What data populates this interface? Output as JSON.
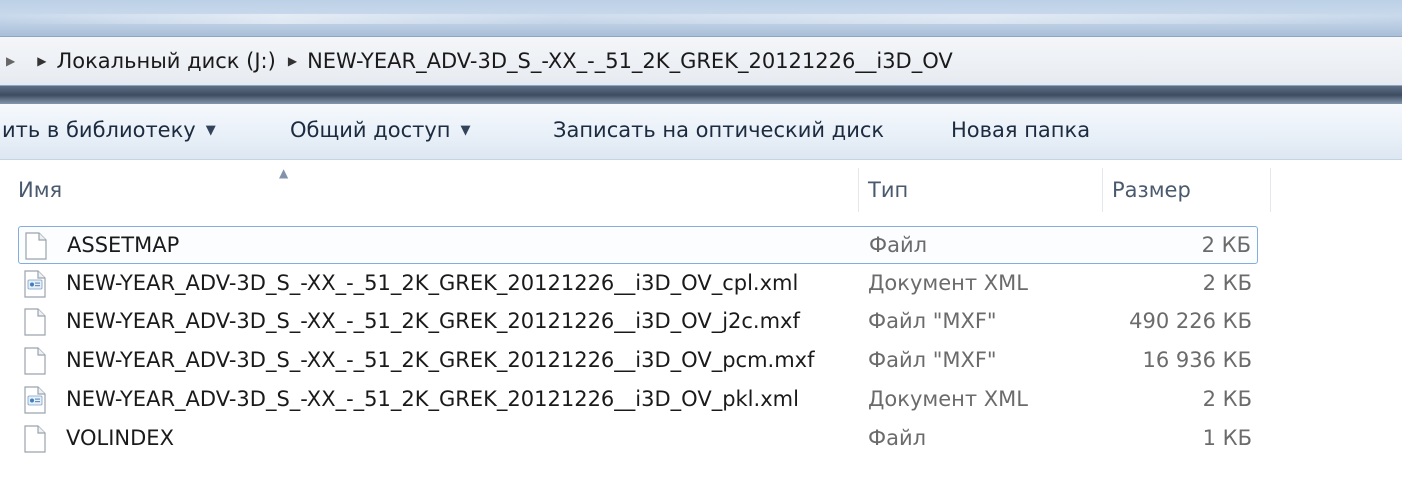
{
  "address_bar": {
    "crumbs": [
      "Локальный диск (J:)",
      "NEW-YEAR_ADV-3D_S_-XX_-_51_2K_GREK_20121226__i3D_OV"
    ]
  },
  "toolbar": {
    "add_to_library": "ить в библиотеку",
    "share": "Общий доступ",
    "burn": "Записать на оптический диск",
    "new_folder": "Новая папка"
  },
  "columns": {
    "name": "Имя",
    "type": "Тип",
    "size": "Размер"
  },
  "files": [
    {
      "name": "ASSETMAP",
      "type": "Файл",
      "size": "2 КБ",
      "icon": "file-icon",
      "selected": true
    },
    {
      "name": "NEW-YEAR_ADV-3D_S_-XX_-_51_2K_GREK_20121226__i3D_OV_cpl.xml",
      "type": "Документ XML",
      "size": "2 КБ",
      "icon": "xml-file-icon",
      "selected": false
    },
    {
      "name": "NEW-YEAR_ADV-3D_S_-XX_-_51_2K_GREK_20121226__i3D_OV_j2c.mxf",
      "type": "Файл \"MXF\"",
      "size": "490 226 КБ",
      "icon": "file-icon",
      "selected": false
    },
    {
      "name": "NEW-YEAR_ADV-3D_S_-XX_-_51_2K_GREK_20121226__i3D_OV_pcm.mxf",
      "type": "Файл \"MXF\"",
      "size": "16 936 КБ",
      "icon": "file-icon",
      "selected": false
    },
    {
      "name": "NEW-YEAR_ADV-3D_S_-XX_-_51_2K_GREK_20121226__i3D_OV_pkl.xml",
      "type": "Документ XML",
      "size": "2 КБ",
      "icon": "xml-file-icon",
      "selected": false
    },
    {
      "name": "VOLINDEX",
      "type": "Файл",
      "size": "1 КБ",
      "icon": "file-icon",
      "selected": false
    }
  ],
  "colors": {
    "selection_border": "#84acdd",
    "toolbar_text": "#1c2b3f"
  }
}
